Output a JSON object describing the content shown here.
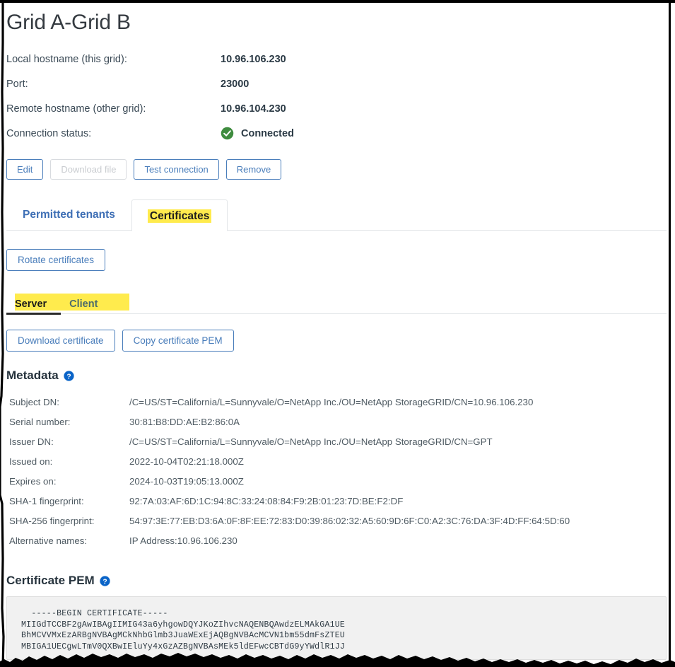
{
  "page": {
    "title": "Grid A-Grid B"
  },
  "summary": {
    "rows": [
      {
        "label": "Local hostname (this grid):",
        "value": "10.96.106.230",
        "icon": null
      },
      {
        "label": "Port:",
        "value": "23000",
        "icon": null
      },
      {
        "label": "Remote hostname (other grid):",
        "value": "10.96.104.230",
        "icon": null
      },
      {
        "label": "Connection status:",
        "value": "Connected",
        "icon": "check-circle-icon"
      }
    ]
  },
  "actions": {
    "edit": "Edit",
    "download_file": "Download file",
    "test_connection": "Test connection",
    "remove": "Remove"
  },
  "tabs": {
    "items": [
      {
        "label": "Permitted tenants",
        "active": false,
        "highlighted": false
      },
      {
        "label": "Certificates",
        "active": true,
        "highlighted": true
      }
    ]
  },
  "rotate": {
    "label": "Rotate certificates"
  },
  "subtabs": {
    "items": [
      {
        "label": "Server",
        "active": true
      },
      {
        "label": "Client",
        "active": false
      }
    ]
  },
  "cert_actions": {
    "download_certificate": "Download certificate",
    "copy_certificate_pem": "Copy certificate PEM"
  },
  "metadata": {
    "heading": "Metadata",
    "help_icon": "help-circle-icon",
    "rows": [
      {
        "key": "Subject DN:",
        "value": "/C=US/ST=California/L=Sunnyvale/O=NetApp Inc./OU=NetApp StorageGRID/CN=10.96.106.230"
      },
      {
        "key": "Serial number:",
        "value": "30:81:B8:DD:AE:B2:86:0A"
      },
      {
        "key": "Issuer DN:",
        "value": "/C=US/ST=California/L=Sunnyvale/O=NetApp Inc./OU=NetApp StorageGRID/CN=GPT"
      },
      {
        "key": "Issued on:",
        "value": "2022-10-04T02:21:18.000Z"
      },
      {
        "key": "Expires on:",
        "value": "2024-10-03T19:05:13.000Z"
      },
      {
        "key": "SHA-1 fingerprint:",
        "value": "92:7A:03:AF:6D:1C:94:8C:33:24:08:84:F9:2B:01:23:7D:BE:F2:DF"
      },
      {
        "key": "SHA-256 fingerprint:",
        "value": "54:97:3E:77:EB:D3:6A:0F:8F:EE:72:83:D0:39:86:02:32:A5:60:9D:6F:C0:A2:3C:76:DA:3F:4D:FF:64:5D:60"
      },
      {
        "key": "Alternative names:",
        "value": "IP Address:10.96.106.230"
      }
    ]
  },
  "certificate_pem": {
    "heading": "Certificate PEM",
    "help_icon": "help-circle-icon",
    "text": "  -----BEGIN CERTIFICATE-----\nMIIGdTCCBF2gAwIBAgIIMIG43a6yhgowDQYJKoZIhvcNAQENBQAwdzELMAkGA1UE\nBhMCVVMxEzARBgNVBAgMCkNhbGlmb3JuaWExEjAQBgNVBAcMCVN1bm55dmFsZTEU\nMBIGA1UECgwLTmV0QXBwIEluYy4xGzAZBgNVBAsMEk5ldEFwcCBTdG9yYWdlR1JJ"
  },
  "colors": {
    "accent_blue": "#4a7ebb",
    "tab_blue": "#3e6fb5",
    "highlight_yellow": "#ffeb4d",
    "status_green": "#3f8c3f",
    "help_blue": "#0a64c8",
    "pem_background": "#f1f1f1"
  }
}
